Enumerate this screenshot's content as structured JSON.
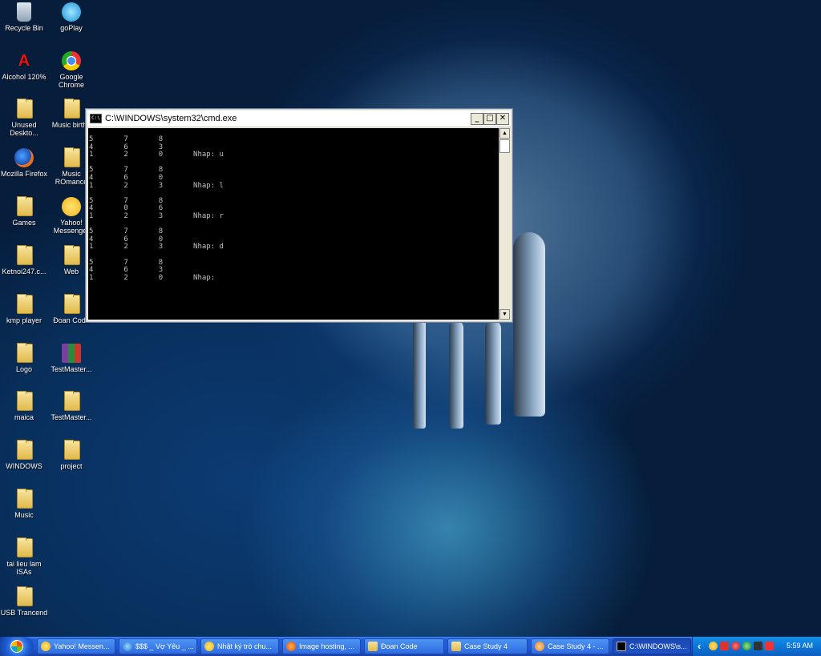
{
  "desktop": {
    "icons_col1": [
      {
        "label": "Recycle Bin",
        "icon": "recycle-bin-icon"
      },
      {
        "label": "Alcohol 120%",
        "icon": "alcohol-icon"
      },
      {
        "label": "Unused Deskto...",
        "icon": "folder-icon"
      },
      {
        "label": "Mozilla Firefox",
        "icon": "firefox-icon"
      },
      {
        "label": "Games",
        "icon": "folder-icon"
      },
      {
        "label": "Ketnoi247.c...",
        "icon": "folder-icon"
      },
      {
        "label": "kmp player",
        "icon": "folder-icon"
      },
      {
        "label": "Logo",
        "icon": "folder-icon"
      },
      {
        "label": "maica",
        "icon": "folder-icon"
      },
      {
        "label": "WINDOWS",
        "icon": "folder-icon"
      },
      {
        "label": "Music",
        "icon": "folder-icon"
      },
      {
        "label": "tai lieu lam ISAs",
        "icon": "folder-icon"
      },
      {
        "label": "USB Trancend",
        "icon": "folder-icon"
      }
    ],
    "icons_col2": [
      {
        "label": "goPlay",
        "icon": "goplay-icon"
      },
      {
        "label": "Google Chrome",
        "icon": "chrome-icon"
      },
      {
        "label": "Music birthd",
        "icon": "folder-icon"
      },
      {
        "label": "Music ROmance",
        "icon": "folder-icon"
      },
      {
        "label": "Yahoo! Messenger",
        "icon": "yahoo-messenger-icon"
      },
      {
        "label": "Web",
        "icon": "folder-icon"
      },
      {
        "label": "Đoan Code",
        "icon": "folder-icon"
      },
      {
        "label": "TestMaster...",
        "icon": "winrar-icon"
      },
      {
        "label": "TestMaster...",
        "icon": "folder-icon"
      },
      {
        "label": "project",
        "icon": "folder-icon"
      }
    ]
  },
  "cmd_window": {
    "title": "C:\\WINDOWS\\system32\\cmd.exe",
    "minimize": "_",
    "maximize": "□",
    "close": "✕",
    "scroll_up": "▲",
    "scroll_down": "▼",
    "console_text": "5       7       8\n4       6       3\n1       2       0       Nhap: u\n\n5       7       8\n4       6       0\n1       2       3       Nhap: l\n\n5       7       8\n4       0       6\n1       2       3       Nhap: r\n\n5       7       8\n4       6       0\n1       2       3       Nhap: d\n\n5       7       8\n4       6       3\n1       2       0       Nhap:"
  },
  "taskbar": {
    "buttons": [
      {
        "label": "Yahoo! Messen...",
        "icon": "yahoo-icon"
      },
      {
        "label": "$$$ _ Vợ Yêu _ ...",
        "icon": "ie-icon"
      },
      {
        "label": "Nhật ký trò chu...",
        "icon": "yahoo-icon"
      },
      {
        "label": "Image hosting, ...",
        "icon": "firefox-icon"
      },
      {
        "label": "Đoan Code",
        "icon": "folder-icon"
      },
      {
        "label": "Case Study 4",
        "icon": "folder-icon"
      },
      {
        "label": "Case Study 4 - ...",
        "icon": "word-icon"
      },
      {
        "label": "C:\\WINDOWS\\s...",
        "icon": "cmd-icon"
      }
    ],
    "tray_chevron": "‹",
    "clock": "5:59 AM"
  }
}
